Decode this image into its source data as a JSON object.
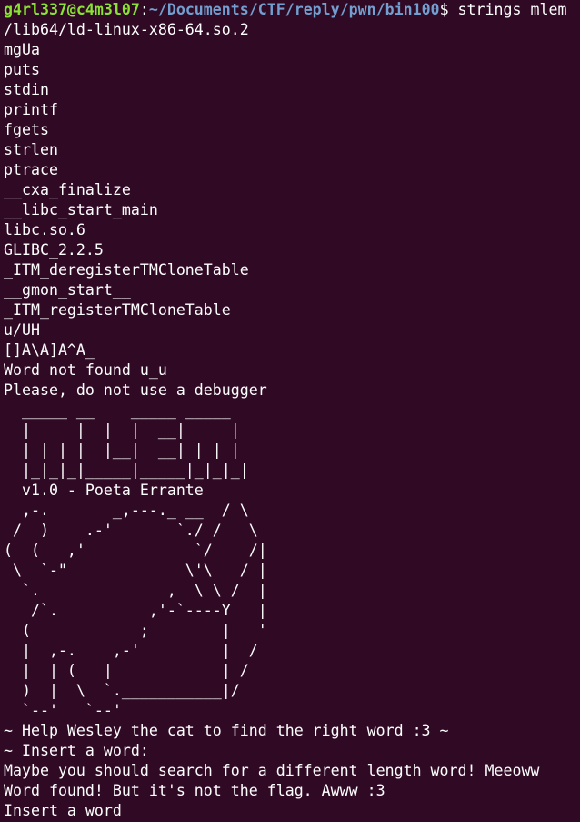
{
  "terminal": {
    "prompt": {
      "user_host": "g4rl337@c4m3l07",
      "separator": ":",
      "path": "~/Documents/CTF/reply/pwn/bin100",
      "dollar": "$ ",
      "command": "strings mlem"
    },
    "output": [
      "/lib64/ld-linux-x86-64.so.2",
      "mgUa",
      "puts",
      "stdin",
      "printf",
      "fgets",
      "strlen",
      "ptrace",
      "__cxa_finalize",
      "__libc_start_main",
      "libc.so.6",
      "GLIBC_2.2.5",
      "_ITM_deregisterTMCloneTable",
      "__gmon_start__",
      "_ITM_registerTMCloneTable",
      "u/UH",
      "[]A\\A]A^A_",
      "Word not found u_u",
      "Please, do not use a debugger",
      "  _____ __    _____ _____",
      "  |     |  |  |  __|     |",
      "  | | | |  |__|  __| | | |",
      "  |_|_|_|_____|_____|_|_|_|",
      "  v1.0 - Poeta Errante",
      "  ,-.       _,---._ __  / \\",
      " /  )    .-'       `./ /   \\",
      "(  (   ,'            `/    /|",
      " \\  `-\"             \\'\\   / |",
      "  `.              ,  \\ \\ /  |",
      "   /`.          ,'-`----Y   |",
      "  (            ;        |   '",
      "  |  ,-.    ,-'         |  /",
      "  |  | (   |            | /",
      "  )  |  \\  `.___________|/",
      "  `--'   `--'",
      "~ Help Wesley the cat to find the right word :3 ~",
      "~ Insert a word:",
      "Maybe you should search for a different length word! Meeoww",
      "Word found! But it's not the flag. Awww :3",
      "Insert a word"
    ]
  },
  "colors": {
    "background": "#300a24",
    "text": "#ffffff",
    "user_host": "#8ae234",
    "path": "#729fcf"
  }
}
